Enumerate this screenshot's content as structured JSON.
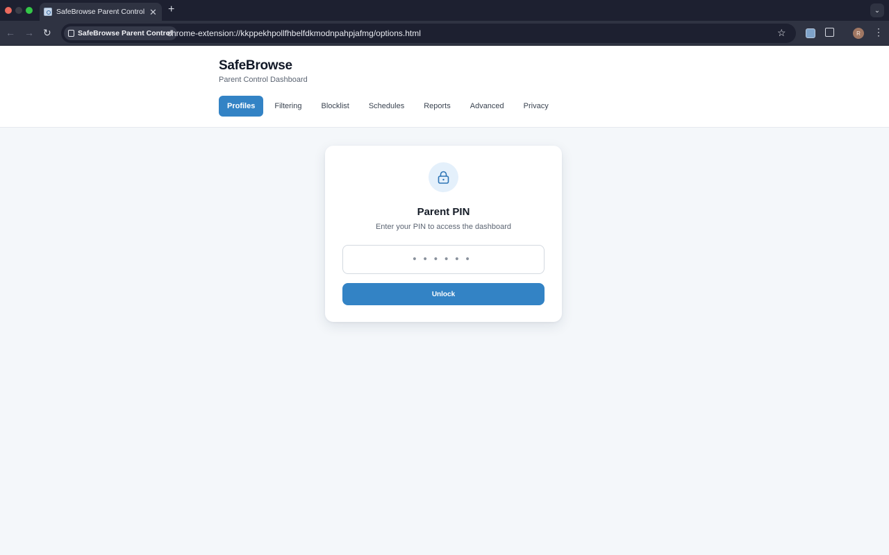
{
  "browser": {
    "tab_title": "SafeBrowse Parent Control - S",
    "tab_close": "✕",
    "new_tab": "+",
    "site_chip": "SafeBrowse Parent Control",
    "url": "chrome-extension://kkppekhpollfhbelfdkmodnpahpjafmg/options.html",
    "avatar_initial": "R"
  },
  "header": {
    "title": "SafeBrowse",
    "subtitle": "Parent Control Dashboard"
  },
  "nav": {
    "tabs": [
      {
        "label": "Profiles",
        "active": true
      },
      {
        "label": "Filtering",
        "active": false
      },
      {
        "label": "Blocklist",
        "active": false
      },
      {
        "label": "Schedules",
        "active": false
      },
      {
        "label": "Reports",
        "active": false
      },
      {
        "label": "Advanced",
        "active": false
      },
      {
        "label": "Privacy",
        "active": false
      }
    ]
  },
  "pin_card": {
    "icon": "lock-icon",
    "title": "Parent PIN",
    "subtitle": "Enter your PIN to access the dashboard",
    "input_placeholder": "••••••",
    "input_value": "",
    "button_label": "Unlock"
  },
  "colors": {
    "accent": "#3383c5",
    "icon_bg": "#e4f0fb",
    "page_bg": "#f4f7fa",
    "browser_frame": "#1d2030"
  }
}
